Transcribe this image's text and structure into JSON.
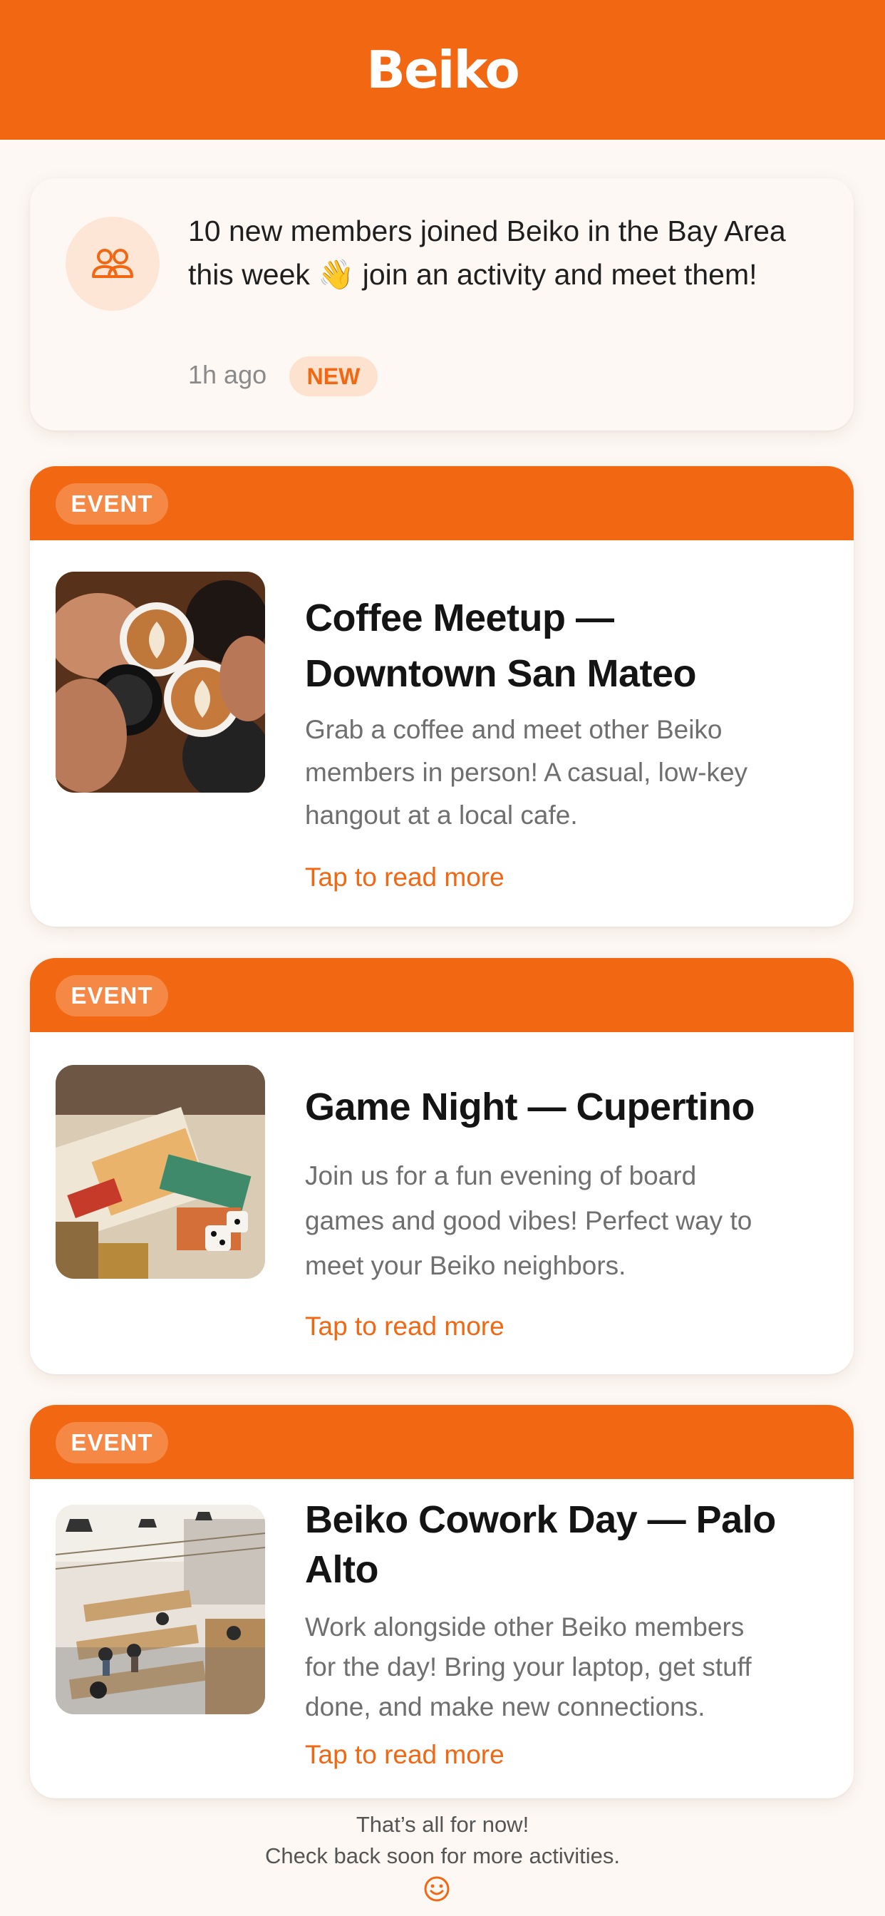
{
  "header": {
    "title": "Beiko"
  },
  "notification": {
    "icon": "people-group-icon",
    "text": "10 new members joined Beiko in the Bay Area this week 👋  join an activity and meet them!",
    "time": "1h ago",
    "badge": "NEW"
  },
  "events": [
    {
      "tag": "EVENT",
      "image": "coffee-cups-photo",
      "title": "Coffee Meetup — Downtown San Mateo",
      "description": "Grab a coffee and meet other Beiko members in person! A casual, low-key hangout at a local cafe.",
      "link": "Tap to read more"
    },
    {
      "tag": "EVENT",
      "image": "board-games-photo",
      "title": "Game Night — Cupertino",
      "description": "Join us for a fun evening of board games and good vibes! Perfect way to meet your Beiko neighbors.",
      "link": "Tap to read more"
    },
    {
      "tag": "EVENT",
      "image": "coworking-space-photo",
      "title": "Beiko Cowork Day — Palo Alto",
      "description": "Work alongside other Beiko members for the day! Bring your laptop, get stuff done, and make new connections.",
      "link": "Tap to read more"
    }
  ],
  "footer": {
    "line1": "That’s all for now!",
    "line2": "Check back soon for more activities.",
    "icon": "smiley-icon"
  },
  "colors": {
    "brand": "#f26711",
    "background": "#fdf8f4",
    "badge_bg": "#fde3cf"
  }
}
